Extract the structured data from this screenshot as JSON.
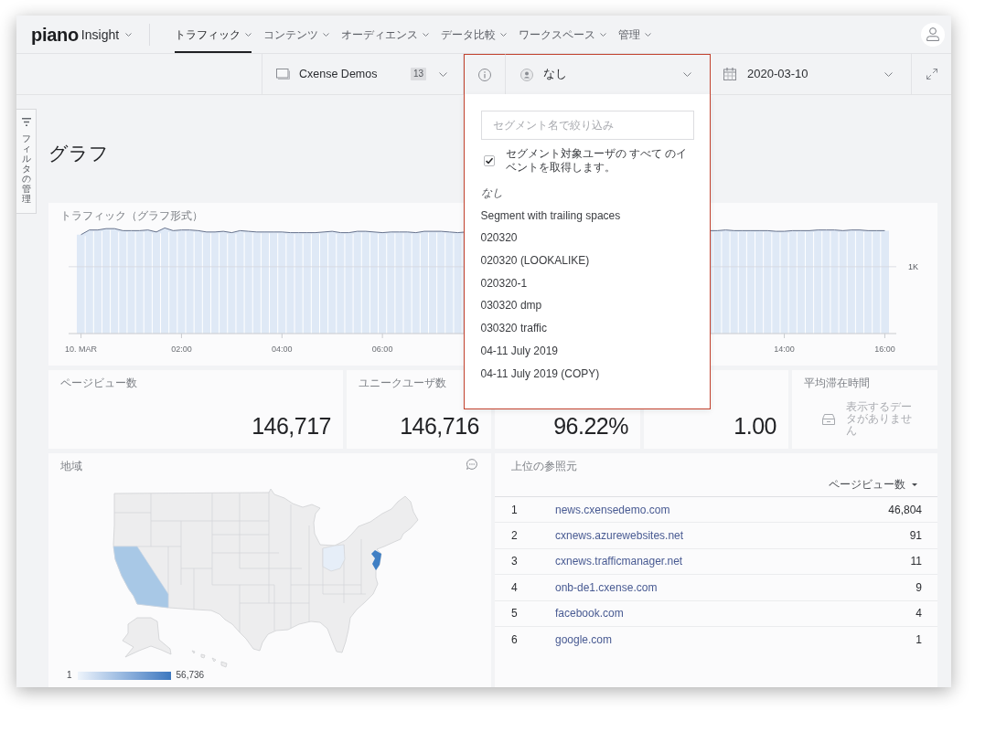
{
  "header": {
    "logo": "piano",
    "product": "Insight",
    "nav": [
      {
        "label": "トラフィック",
        "selected": true
      },
      {
        "label": "コンテンツ",
        "selected": false
      },
      {
        "label": "オーディエンス",
        "selected": false
      },
      {
        "label": "データ比較",
        "selected": false
      },
      {
        "label": "ワークスペース",
        "selected": false
      },
      {
        "label": "管理",
        "selected": false
      }
    ]
  },
  "toolbar": {
    "site": {
      "name": "Cxense Demos",
      "count": "13"
    },
    "segment": {
      "value": "なし",
      "expanded": true,
      "menu": {
        "search": {
          "placeholder": "セグメント名で絞り込み"
        },
        "all_events": {
          "label": "セグメント対象ユーザの すべて のイベントを取得します。",
          "checked": true
        },
        "options": [
          {
            "label": "なし",
            "kind": "none"
          },
          {
            "label": "Segment with trailing spaces",
            "kind": "segment"
          },
          {
            "label": "020320",
            "kind": "segment"
          },
          {
            "label": "020320 (LOOKALIKE)",
            "kind": "segment"
          },
          {
            "label": "020320-1",
            "kind": "segment"
          },
          {
            "label": "030320 dmp",
            "kind": "segment"
          },
          {
            "label": "030320 traffic",
            "kind": "segment"
          },
          {
            "label": "04-11 July 2019",
            "kind": "segment"
          },
          {
            "label": "04-11 July 2019 (COPY)",
            "kind": "segment"
          }
        ]
      }
    },
    "date": {
      "value": "2020-03-10"
    }
  },
  "filter_tab": {
    "label": "フィルタの管理"
  },
  "page_title": "グラフ",
  "traffic": {
    "title": "トラフィック（グラフ形式）",
    "x_labels": [
      "10. MAR",
      "02:00",
      "04:00",
      "06:00",
      "14:00",
      "16:00"
    ],
    "y_label": "1K"
  },
  "metrics": [
    {
      "kind": "number",
      "label": "ページビュー数",
      "value": "146,717"
    },
    {
      "kind": "number",
      "label": "ユニークユーザ数",
      "value": "146,716"
    },
    {
      "kind": "number",
      "value": "96.22%"
    },
    {
      "kind": "number",
      "value": "1.00"
    },
    {
      "kind": "empty",
      "label": "平均滞在時間",
      "message": "表示するデータがありません"
    }
  ],
  "region_map": {
    "title": "地域",
    "legend_min": "1",
    "legend_max": "56,736"
  },
  "referrers": {
    "title": "上位の参照元",
    "column": "ページビュー数",
    "rows": [
      {
        "rank": "1",
        "site": "news.cxensedemo.com",
        "pageviews": "46,804"
      },
      {
        "rank": "2",
        "site": "cxnews.azurewebsites.net",
        "pageviews": "91"
      },
      {
        "rank": "3",
        "site": "cxnews.trafficmanager.net",
        "pageviews": "11"
      },
      {
        "rank": "4",
        "site": "onb-de1.cxense.com",
        "pageviews": "9"
      },
      {
        "rank": "5",
        "site": "facebook.com",
        "pageviews": "4"
      },
      {
        "rank": "6",
        "site": "google.com",
        "pageviews": "1"
      }
    ]
  }
}
